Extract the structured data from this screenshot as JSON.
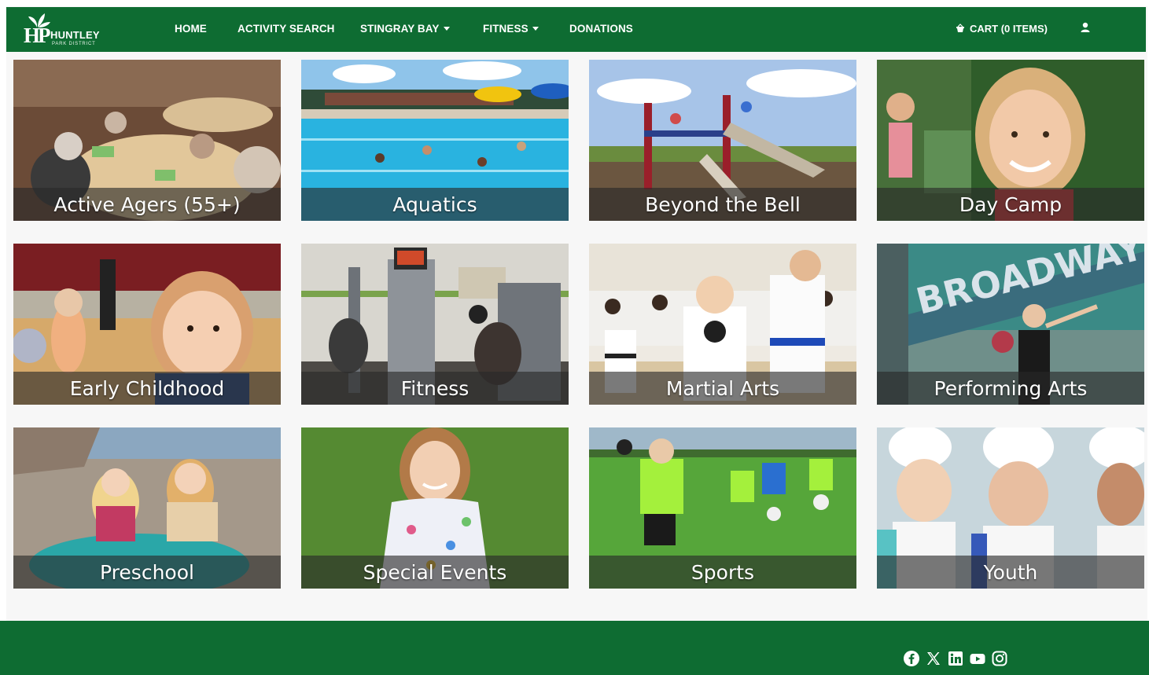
{
  "colors": {
    "brand_green": "#0e6c32",
    "page_bg": "#f7f7f7",
    "label_band": "rgba(40,40,40,0.62)"
  },
  "logo": {
    "initials": "HP",
    "name": "HUNTLEY",
    "subtitle": "PARK DISTRICT"
  },
  "nav": {
    "home": "HOME",
    "activity_search": "ACTIVITY SEARCH",
    "stingray_bay": "STINGRAY BAY",
    "fitness": "FITNESS",
    "donations": "DONATIONS",
    "cart": "CART (0 ITEMS)"
  },
  "icons": {
    "cart": "basket-icon",
    "user": "user-icon",
    "dropdown": "caret-down-icon"
  },
  "tiles": [
    {
      "label": "Active Agers (55+)"
    },
    {
      "label": "Aquatics"
    },
    {
      "label": "Beyond the Bell"
    },
    {
      "label": "Day Camp"
    },
    {
      "label": "Early Childhood"
    },
    {
      "label": "Fitness"
    },
    {
      "label": "Martial Arts"
    },
    {
      "label": "Performing Arts"
    },
    {
      "label": "Preschool"
    },
    {
      "label": "Special Events"
    },
    {
      "label": "Sports"
    },
    {
      "label": "Youth"
    }
  ],
  "photo_overlay_text": {
    "performing_arts_sign": "BROADWAY"
  },
  "footer": {
    "social": [
      "facebook-icon",
      "x-icon",
      "linkedin-icon",
      "youtube-icon",
      "instagram-icon"
    ]
  }
}
